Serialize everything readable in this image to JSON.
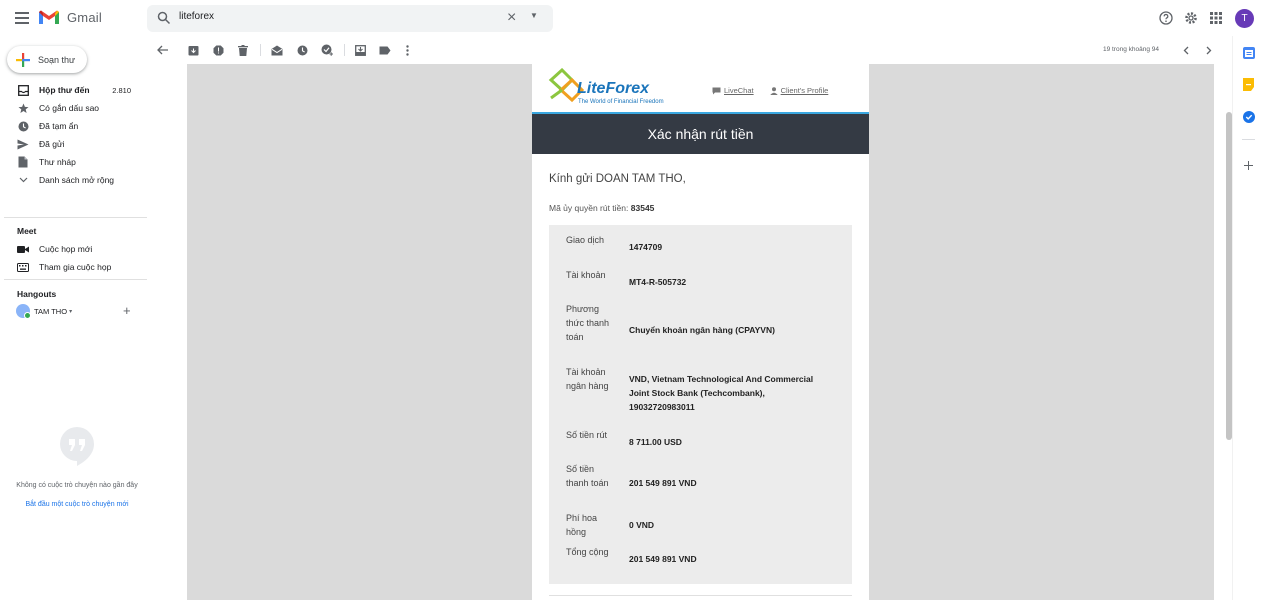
{
  "app": {
    "name": "Gmail"
  },
  "search": {
    "value": "liteforex",
    "clear_symbol": "×",
    "options_symbol": "▼"
  },
  "user": {
    "initial": "T"
  },
  "compose": {
    "label": "Soạn thư"
  },
  "nav": [
    {
      "label": "Hộp thư đến",
      "count": "2.810",
      "icon": "inbox-icon",
      "bold": true
    },
    {
      "label": "Có gắn dấu sao",
      "icon": "star-icon"
    },
    {
      "label": "Đã tạm ẩn",
      "icon": "clock-icon"
    },
    {
      "label": "Đã gửi",
      "icon": "send-icon"
    },
    {
      "label": "Thư nháp",
      "icon": "draft-icon"
    },
    {
      "label": "Danh sách mở rộng",
      "icon": "chevron-down-icon"
    }
  ],
  "meet": {
    "title": "Meet",
    "new_meeting": "Cuộc họp mới",
    "join_meeting": "Tham gia cuộc họp"
  },
  "hangouts": {
    "title": "Hangouts",
    "user_name": "TAM THO",
    "caret": "▾",
    "add_symbol": "+",
    "empty_text": "Không có cuộc trò chuyện nào gần đây",
    "start_link": "Bắt đầu một cuộc trò chuyện mới"
  },
  "pager": {
    "text": "19 trong khoảng 94"
  },
  "email": {
    "brand": "LiteForex",
    "tagline": "The World of Financial Freedom",
    "livechat": "LiveChat",
    "profile": "Client's Profile",
    "title": "Xác nhận rút tiền",
    "greeting": "Kính gửi DOAN TAM THO,",
    "auth_label": "Mã ủy quyền rút tiền:",
    "auth_code": "83545",
    "rows": [
      {
        "label": "Giao dịch",
        "value": "1474709"
      },
      {
        "label": "Tài khoản",
        "value": "MT4-R-505732"
      },
      {
        "label": "Phương thức thanh toán",
        "value": "Chuyển khoản ngân hàng (CPAYVN)"
      },
      {
        "label": "Tài khoản ngân hàng",
        "value": "VND, Vietnam Technological And Commercial Joint Stock Bank (Techcombank), 19032720983011"
      },
      {
        "label": "Số tiền rút",
        "value": "8 711.00 USD"
      },
      {
        "label": "Số tiền thanh toán",
        "value": "201 549 891 VND"
      },
      {
        "label": "Phí hoa hồng",
        "value": "0 VND"
      },
      {
        "label": "Tổng cộng",
        "value": "201 549 891 VND"
      }
    ]
  },
  "colors": {
    "title_bar": "#343a44",
    "title_accent": "#3aa7e0",
    "brand_orange": "#f0a020",
    "brand_green": "#8cc63f",
    "brand_blue": "#1b75bb",
    "avatar": "#673ab7"
  }
}
